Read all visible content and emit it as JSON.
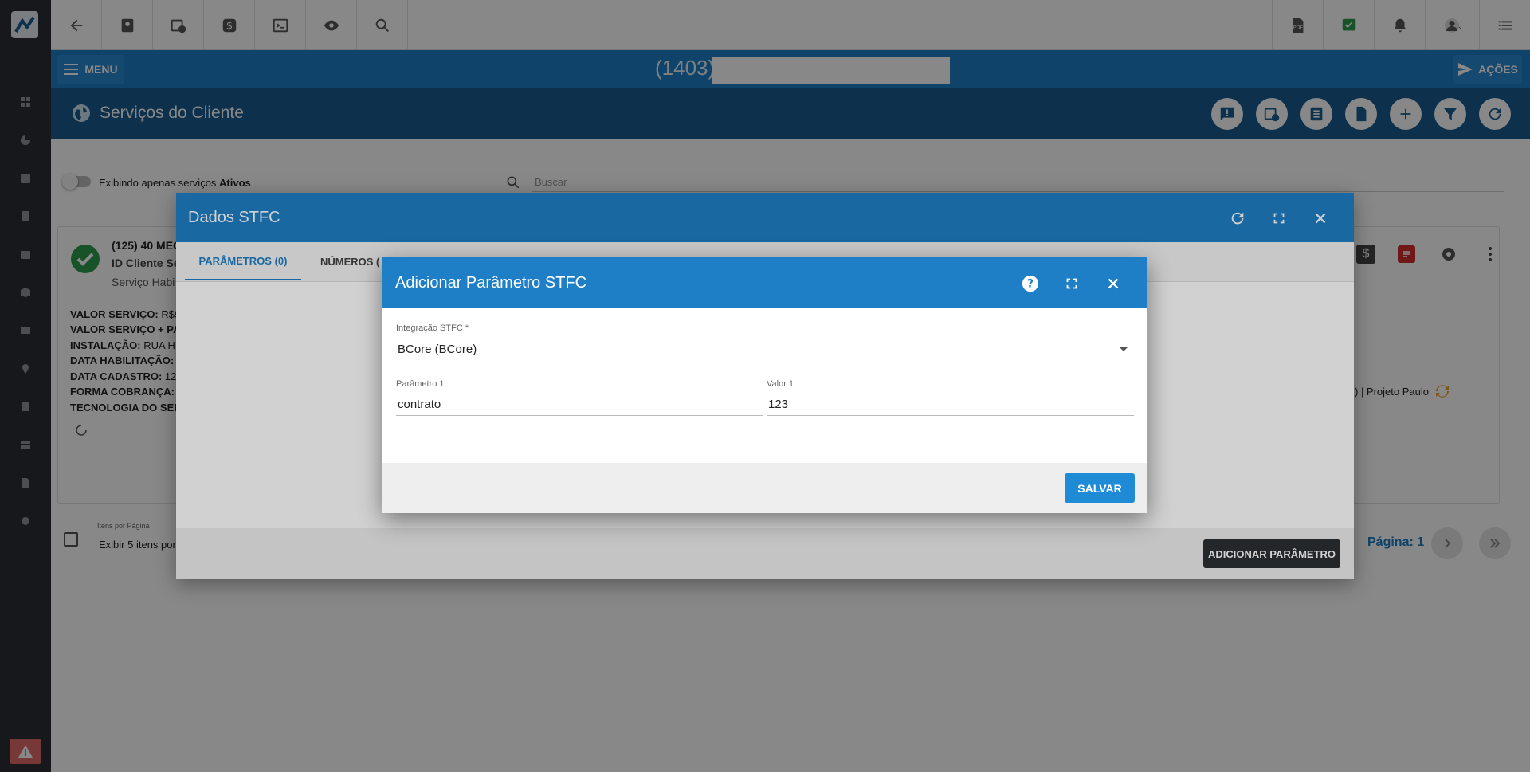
{
  "topbar": {
    "icons": [
      "back-arrow-icon",
      "contact-card-icon",
      "calendar-clock-icon",
      "dollar-icon",
      "terminal-icon",
      "eye-icon",
      "search-icon"
    ],
    "right_icons": [
      "pdf-icon",
      "check-chat-icon",
      "bell-icon",
      "avatar",
      "list-icon"
    ]
  },
  "header": {
    "menu_label": "MENU",
    "client_code": "(1403)",
    "acoes_label": "AÇÕES"
  },
  "page": {
    "title": "Serviços do Cliente"
  },
  "filter": {
    "toggle_label_prefix": "Exibindo apenas serviços ",
    "toggle_label_bold": "Ativos",
    "search_placeholder": "Buscar"
  },
  "service": {
    "title": "(125) 40 MEG",
    "id_label": "ID Cliente Se",
    "status_label": "Serviço Habi",
    "lines": [
      {
        "label": "VALOR SERVIÇO:",
        "value": " R$9"
      },
      {
        "label": "VALOR SERVIÇO + PA",
        "value": ""
      },
      {
        "label": "INSTALAÇÃO:",
        "value": " RUA H"
      },
      {
        "label": "DATA HABILITAÇÃO:",
        "value": ""
      },
      {
        "label": "DATA CADASTRO:",
        "value": " 12"
      },
      {
        "label": "FORMA COBRANÇA:",
        "value": ""
      },
      {
        "label": "TECNOLOGIA DO SER",
        "value": ""
      }
    ],
    "project_text": ") | Projeto Paulo"
  },
  "pagination": {
    "items_label": "Itens por Página",
    "items_value": "Exibir 5 itens por",
    "page_label": "Página: 1"
  },
  "modal_stfc": {
    "title": "Dados STFC",
    "tabs": [
      "PARÂMETROS (0)",
      "NÚMEROS ("
    ],
    "add_button": "ADICIONAR PARÂMETRO"
  },
  "modal_param": {
    "title": "Adicionar Parâmetro STFC",
    "integration_label": "Integração STFC *",
    "integration_value": "BCore (BCore)",
    "param1_label": "Parâmetro 1",
    "param1_value": "contrato",
    "valor1_label": "Valor 1",
    "valor1_value": "123",
    "save_button": "SALVAR"
  },
  "colors": {
    "primary": "#1f7fc6",
    "dark_header": "#195b92",
    "sidebar": "#2c2f33",
    "success": "#2e9b4e",
    "danger": "#d32f2f",
    "warning": "#e26b6b",
    "orange": "#f0a020"
  }
}
